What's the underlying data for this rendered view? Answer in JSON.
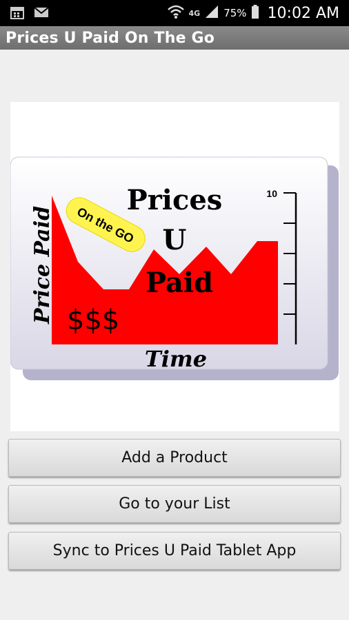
{
  "status_bar": {
    "network": "4G",
    "battery_percent": "75%",
    "time": "10:02 AM",
    "icons": [
      "calendar-icon",
      "mail-icon",
      "wifi-icon",
      "signal-icon",
      "battery-icon"
    ]
  },
  "app_bar": {
    "title": "Prices U Paid On The Go"
  },
  "logo": {
    "title_line1": "Prices",
    "title_line2": "U",
    "title_line3": "Paid",
    "badge": "On the GO",
    "y_axis_label": "Price Paid",
    "x_axis_label": "Time",
    "currency": "$$$",
    "scale_max": "10",
    "colors": {
      "area": "#ff0000",
      "badge": "#fff44f",
      "card": "#e9e8f2",
      "card_shadow": "#b5b2cc"
    }
  },
  "buttons": {
    "add_product": "Add a Product",
    "go_to_list": "Go to your List",
    "sync": "Sync to Prices U Paid Tablet App"
  }
}
